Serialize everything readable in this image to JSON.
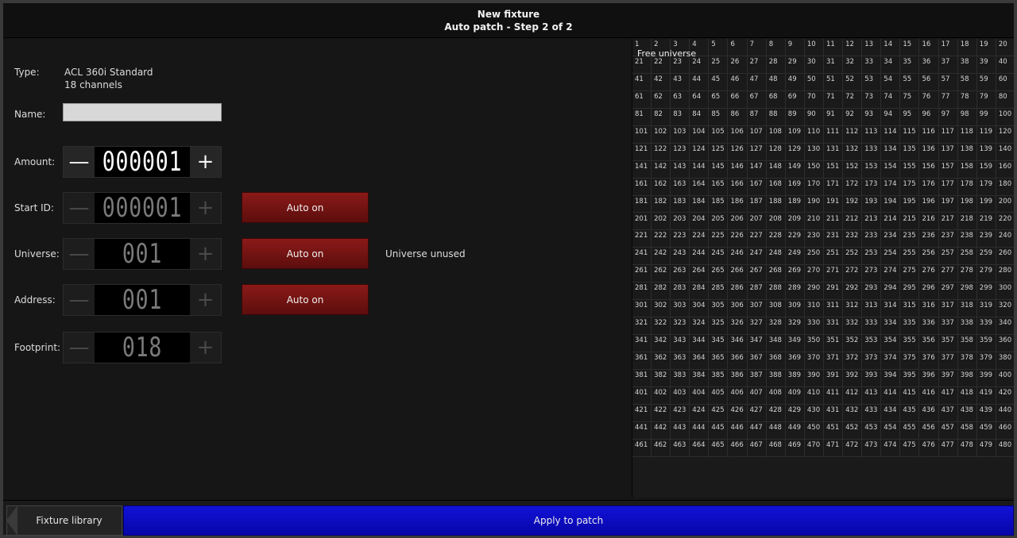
{
  "header": {
    "title": "New fixture",
    "subtitle": "Auto patch - Step 2 of 2"
  },
  "form": {
    "type_label": "Type:",
    "type_value": "ACL 360i Standard",
    "channels_value": "18 channels",
    "name_label": "Name:",
    "name_value": "",
    "amount_label": "Amount:",
    "amount_value": "000001",
    "start_id_label": "Start ID:",
    "start_id_value": "000001",
    "start_id_auto": "Auto on",
    "universe_label": "Universe:",
    "universe_value": "001",
    "universe_auto": "Auto on",
    "universe_note": "Universe unused",
    "address_label": "Address:",
    "address_value": "001",
    "address_auto": "Auto on",
    "footprint_label": "Footprint:",
    "footprint_value": "018",
    "minus_glyph": "—",
    "plus_glyph": "+"
  },
  "grid": {
    "overlay_label": "Free universe",
    "columns": 20,
    "rows": 24,
    "start": 1
  },
  "footer": {
    "back_label": "Fixture library",
    "apply_label": "Apply to patch"
  },
  "colors": {
    "accent_blue": "#0a0ac0",
    "auto_red": "#7a1614",
    "background": "#161616"
  }
}
